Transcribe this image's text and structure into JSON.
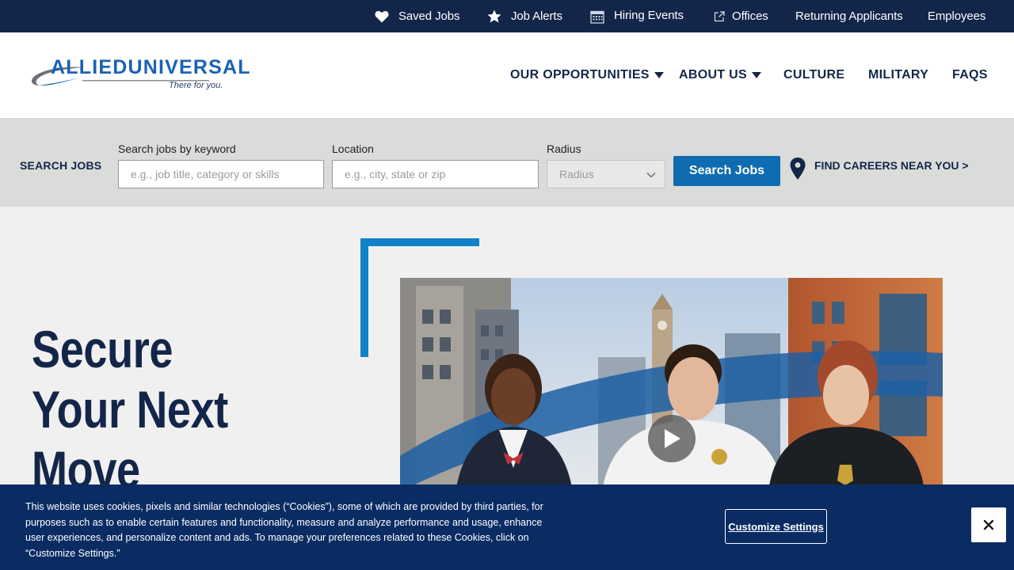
{
  "utility_nav": {
    "saved_jobs": "Saved Jobs",
    "job_alerts": "Job Alerts",
    "hiring_events": "Hiring Events",
    "offices": "Offices",
    "returning_applicants": "Returning Applicants",
    "employees": "Employees"
  },
  "logo": {
    "wordmark": "ALLIEDUNIVERSAL",
    "tagline": "There for you."
  },
  "main_nav": {
    "our_opportunities": "OUR OPPORTUNITIES",
    "about_us": "ABOUT US",
    "culture": "CULTURE",
    "military": "MILITARY",
    "faqs": "FAQS"
  },
  "search": {
    "heading": "SEARCH JOBS",
    "keyword_label": "Search jobs by keyword",
    "keyword_placeholder": "e.g., job title, category or skills",
    "location_label": "Location",
    "location_placeholder": "e.g., city, state or zip",
    "radius_label": "Radius",
    "radius_selected": "Radius",
    "button": "Search Jobs",
    "near_link": "FIND CAREERS NEAR YOU >"
  },
  "hero": {
    "title_lines": [
      "Secure",
      "Your Next",
      "Move"
    ]
  },
  "cookie_banner": {
    "text": "This website uses cookies, pixels and similar technologies (“Cookies”), some of which are provided by third parties, for purposes such as to enable certain features and functionality, measure and analyze performance and usage, enhance user experiences, and personalize content and ads. To manage your preferences related to these Cookies, click on “Customize Settings.”",
    "customize_button": "Customize Settings",
    "close_symbol": "×"
  },
  "colors": {
    "navy": "#13264a",
    "accent_blue": "#0f6cb0",
    "frame_blue": "#0f82c9",
    "search_band": "#dadcda",
    "cookie_bg": "#0a2c63"
  }
}
